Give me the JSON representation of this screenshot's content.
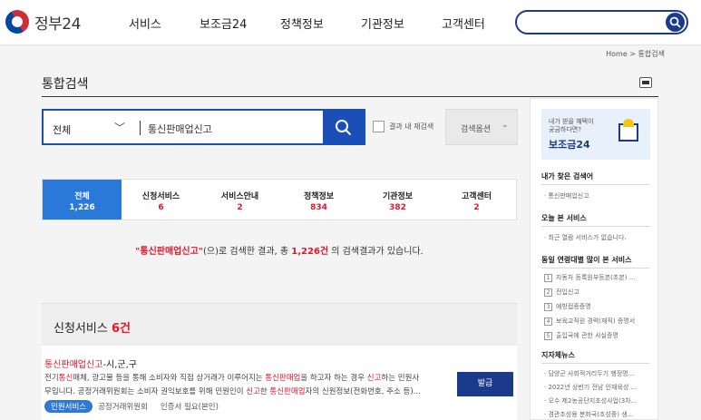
{
  "header": {
    "logo_text": "정부24",
    "nav": [
      "서비스",
      "보조금24",
      "정책정보",
      "기관정보",
      "고객센터"
    ],
    "search_value": ""
  },
  "breadcrumb": "Home > 통합검색",
  "page": {
    "title": "통합검색"
  },
  "search": {
    "scope": "전체",
    "query": "통신판매업신고",
    "research_label": "결과 내 재검색",
    "options_label": "검색옵션"
  },
  "tabs": [
    {
      "label": "전체",
      "count": "1,226"
    },
    {
      "label": "신청서비스",
      "count": "6"
    },
    {
      "label": "서비스안내",
      "count": "2"
    },
    {
      "label": "정책정보",
      "count": "834"
    },
    {
      "label": "기관정보",
      "count": "382"
    },
    {
      "label": "고객센터",
      "count": "2"
    }
  ],
  "summary": {
    "keyword": "\"통신판매업신고\"",
    "pre": "(으)로 검색한 결과, 총 ",
    "total": "1,226건",
    "post": " 의 검색결과가 있습니다."
  },
  "section": {
    "title": "신청서비스",
    "count": "6건"
  },
  "result": {
    "title_hl": "통신판매업신고",
    "title_rest": "-시,군,구",
    "desc1_a": "전기",
    "desc1_b": "통신",
    "desc1_c": "매체, 광고물 등을 통해 소비자와 직접 상거래가 이루어지는 ",
    "desc1_d": "통신판매업",
    "desc1_e": "을 하고자 하는 경우 ",
    "desc1_f": "신고",
    "desc1_g": "하는 민원사",
    "desc2_a": "무입니다. 공정거래위원회는 소비자 권익보호를 위해 민원인이 ",
    "desc2_b": "신고",
    "desc2_c": "한 ",
    "desc2_d": "통신판매업",
    "desc2_e": "자의 신원정보(전화번호, 주소 등)...",
    "tag": "민원서비스",
    "agency": "공정거래위원회",
    "auth": "인증서 필요(본인)",
    "button": "발급"
  },
  "sidebar": {
    "banner_line1": "내가 받을 혜택이",
    "banner_line2": "궁금하다면?",
    "banner_big": "보조금24",
    "recent_title": "내가 찾은 검색어",
    "recent_item": "· 통신판매업신고",
    "viewed_title": "오늘 본 서비스",
    "viewed_item": "· 최근 열람 서비스가 없습니다.",
    "popular_title": "동일 연령대별 많이 본 서비스",
    "popular": [
      "자동차 등록원부등본(초본) ...",
      "전입신고",
      "예방접종증명",
      "보육교직원 경력(재직) 증명서",
      "출입국에 관한 사실증명"
    ],
    "news_title": "지자체뉴스",
    "news": [
      "· 담양군 사회적거리두기 행정명...",
      "· 2022년 상반기 전남 인재육성 ...",
      "· 오수 제2농공단지조성사업(3차...",
      "· 경관조성용 분화국(조성중) 생..."
    ]
  }
}
